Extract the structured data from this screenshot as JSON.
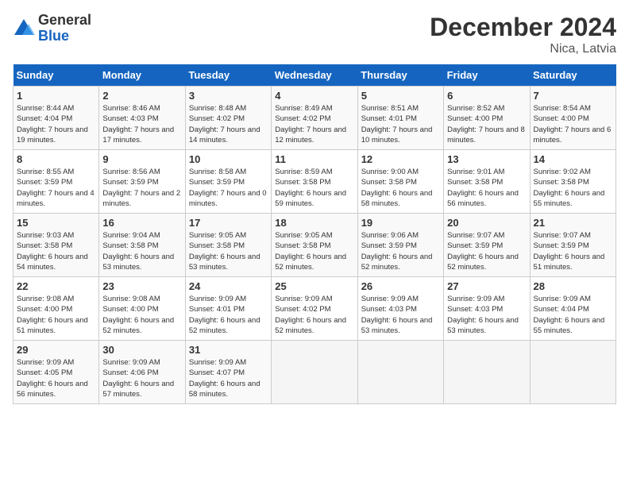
{
  "logo": {
    "general": "General",
    "blue": "Blue"
  },
  "header": {
    "month": "December 2024",
    "location": "Nica, Latvia"
  },
  "weekdays": [
    "Sunday",
    "Monday",
    "Tuesday",
    "Wednesday",
    "Thursday",
    "Friday",
    "Saturday"
  ],
  "weeks": [
    [
      {
        "day": "1",
        "sunrise": "8:44 AM",
        "sunset": "4:04 PM",
        "daylight": "7 hours and 19 minutes."
      },
      {
        "day": "2",
        "sunrise": "8:46 AM",
        "sunset": "4:03 PM",
        "daylight": "7 hours and 17 minutes."
      },
      {
        "day": "3",
        "sunrise": "8:48 AM",
        "sunset": "4:02 PM",
        "daylight": "7 hours and 14 minutes."
      },
      {
        "day": "4",
        "sunrise": "8:49 AM",
        "sunset": "4:02 PM",
        "daylight": "7 hours and 12 minutes."
      },
      {
        "day": "5",
        "sunrise": "8:51 AM",
        "sunset": "4:01 PM",
        "daylight": "7 hours and 10 minutes."
      },
      {
        "day": "6",
        "sunrise": "8:52 AM",
        "sunset": "4:00 PM",
        "daylight": "7 hours and 8 minutes."
      },
      {
        "day": "7",
        "sunrise": "8:54 AM",
        "sunset": "4:00 PM",
        "daylight": "7 hours and 6 minutes."
      }
    ],
    [
      {
        "day": "8",
        "sunrise": "8:55 AM",
        "sunset": "3:59 PM",
        "daylight": "7 hours and 4 minutes."
      },
      {
        "day": "9",
        "sunrise": "8:56 AM",
        "sunset": "3:59 PM",
        "daylight": "7 hours and 2 minutes."
      },
      {
        "day": "10",
        "sunrise": "8:58 AM",
        "sunset": "3:59 PM",
        "daylight": "7 hours and 0 minutes."
      },
      {
        "day": "11",
        "sunrise": "8:59 AM",
        "sunset": "3:58 PM",
        "daylight": "6 hours and 59 minutes."
      },
      {
        "day": "12",
        "sunrise": "9:00 AM",
        "sunset": "3:58 PM",
        "daylight": "6 hours and 58 minutes."
      },
      {
        "day": "13",
        "sunrise": "9:01 AM",
        "sunset": "3:58 PM",
        "daylight": "6 hours and 56 minutes."
      },
      {
        "day": "14",
        "sunrise": "9:02 AM",
        "sunset": "3:58 PM",
        "daylight": "6 hours and 55 minutes."
      }
    ],
    [
      {
        "day": "15",
        "sunrise": "9:03 AM",
        "sunset": "3:58 PM",
        "daylight": "6 hours and 54 minutes."
      },
      {
        "day": "16",
        "sunrise": "9:04 AM",
        "sunset": "3:58 PM",
        "daylight": "6 hours and 53 minutes."
      },
      {
        "day": "17",
        "sunrise": "9:05 AM",
        "sunset": "3:58 PM",
        "daylight": "6 hours and 53 minutes."
      },
      {
        "day": "18",
        "sunrise": "9:05 AM",
        "sunset": "3:58 PM",
        "daylight": "6 hours and 52 minutes."
      },
      {
        "day": "19",
        "sunrise": "9:06 AM",
        "sunset": "3:59 PM",
        "daylight": "6 hours and 52 minutes."
      },
      {
        "day": "20",
        "sunrise": "9:07 AM",
        "sunset": "3:59 PM",
        "daylight": "6 hours and 52 minutes."
      },
      {
        "day": "21",
        "sunrise": "9:07 AM",
        "sunset": "3:59 PM",
        "daylight": "6 hours and 51 minutes."
      }
    ],
    [
      {
        "day": "22",
        "sunrise": "9:08 AM",
        "sunset": "4:00 PM",
        "daylight": "6 hours and 51 minutes."
      },
      {
        "day": "23",
        "sunrise": "9:08 AM",
        "sunset": "4:00 PM",
        "daylight": "6 hours and 52 minutes."
      },
      {
        "day": "24",
        "sunrise": "9:09 AM",
        "sunset": "4:01 PM",
        "daylight": "6 hours and 52 minutes."
      },
      {
        "day": "25",
        "sunrise": "9:09 AM",
        "sunset": "4:02 PM",
        "daylight": "6 hours and 52 minutes."
      },
      {
        "day": "26",
        "sunrise": "9:09 AM",
        "sunset": "4:03 PM",
        "daylight": "6 hours and 53 minutes."
      },
      {
        "day": "27",
        "sunrise": "9:09 AM",
        "sunset": "4:03 PM",
        "daylight": "6 hours and 53 minutes."
      },
      {
        "day": "28",
        "sunrise": "9:09 AM",
        "sunset": "4:04 PM",
        "daylight": "6 hours and 55 minutes."
      }
    ],
    [
      {
        "day": "29",
        "sunrise": "9:09 AM",
        "sunset": "4:05 PM",
        "daylight": "6 hours and 56 minutes."
      },
      {
        "day": "30",
        "sunrise": "9:09 AM",
        "sunset": "4:06 PM",
        "daylight": "6 hours and 57 minutes."
      },
      {
        "day": "31",
        "sunrise": "9:09 AM",
        "sunset": "4:07 PM",
        "daylight": "6 hours and 58 minutes."
      },
      null,
      null,
      null,
      null
    ]
  ]
}
